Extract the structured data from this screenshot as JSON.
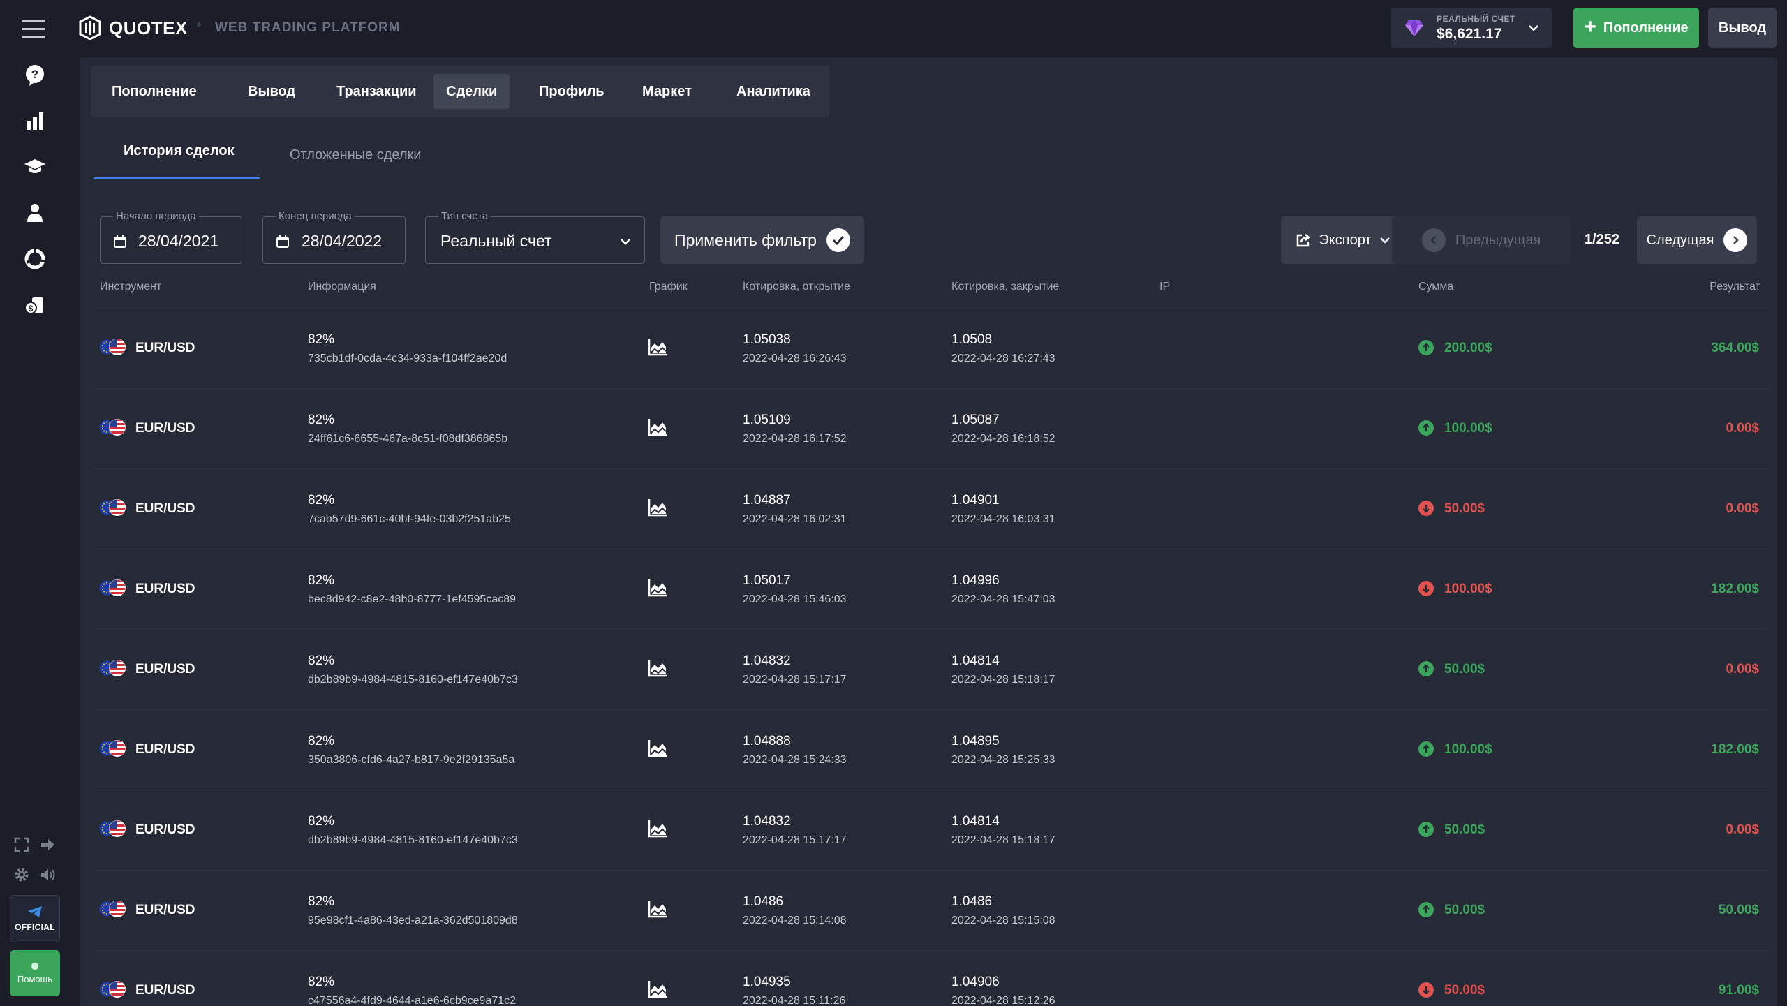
{
  "colors": {
    "green": "#3ba55c",
    "red": "#e0524f",
    "accent_blue": "#3d7be6",
    "background": "#1b1e29",
    "panel": "#262a36"
  },
  "header": {
    "logo": "QUOTEX",
    "tagline": "WEB TRADING PLATFORM",
    "account_label": "РЕАЛЬНЫЙ СЧЕТ",
    "balance": "$6,621.17",
    "deposit_label": "Пополнение",
    "withdraw_label": "Вывод"
  },
  "sidebar": {
    "icons": [
      "menu-icon",
      "help-icon",
      "chart-icon",
      "education-icon",
      "profile-icon",
      "market-icon",
      "coins-icon"
    ],
    "official_label": "OFFICIAL",
    "help_label": "Помощь"
  },
  "nav": {
    "tabs": [
      "Пополнение",
      "Вывод",
      "Транзакции",
      "Сделки",
      "Профиль",
      "Маркет",
      "Аналитика"
    ],
    "active": "Сделки"
  },
  "subtabs": [
    "История сделок",
    "Отложенные сделки"
  ],
  "filters": {
    "start_label": "Начало периода",
    "start_value": "28/04/2021",
    "end_label": "Конец периода",
    "end_value": "28/04/2022",
    "account_type_label": "Тип счета",
    "account_type_value": "Реальный счет",
    "apply_label": "Применить фильтр",
    "export_label": "Экспорт",
    "prev_label": "Предыдущая",
    "page": "1/252",
    "next_label": "Следущая"
  },
  "table": {
    "headers": [
      "Инструмент",
      "Информация",
      "График",
      "Котировка, открытие",
      "Котировка, закрытие",
      "IP",
      "Сумма",
      "Результат"
    ],
    "rows": [
      {
        "instrument": "EUR/USD",
        "percent": "82%",
        "id": "735cb1df-0cda-4c34-933a-f104ff2ae20d",
        "open_quote": "1.05038",
        "open_time": "2022-04-28 16:26:43",
        "close_quote": "1.0508",
        "close_time": "2022-04-28 16:27:43",
        "ip": "",
        "direction": "up",
        "amount": "200.00$",
        "result": "364.00$",
        "result_positive": true
      },
      {
        "instrument": "EUR/USD",
        "percent": "82%",
        "id": "24ff61c6-6655-467a-8c51-f08df386865b",
        "open_quote": "1.05109",
        "open_time": "2022-04-28 16:17:52",
        "close_quote": "1.05087",
        "close_time": "2022-04-28 16:18:52",
        "ip": "",
        "direction": "up",
        "amount": "100.00$",
        "result": "0.00$",
        "result_positive": false
      },
      {
        "instrument": "EUR/USD",
        "percent": "82%",
        "id": "7cab57d9-661c-40bf-94fe-03b2f251ab25",
        "open_quote": "1.04887",
        "open_time": "2022-04-28 16:02:31",
        "close_quote": "1.04901",
        "close_time": "2022-04-28 16:03:31",
        "ip": "",
        "direction": "down",
        "amount": "50.00$",
        "result": "0.00$",
        "result_positive": false
      },
      {
        "instrument": "EUR/USD",
        "percent": "82%",
        "id": "bec8d942-c8e2-48b0-8777-1ef4595cac89",
        "open_quote": "1.05017",
        "open_time": "2022-04-28 15:46:03",
        "close_quote": "1.04996",
        "close_time": "2022-04-28 15:47:03",
        "ip": "",
        "direction": "down",
        "amount": "100.00$",
        "result": "182.00$",
        "result_positive": true
      },
      {
        "instrument": "EUR/USD",
        "percent": "82%",
        "id": "db2b89b9-4984-4815-8160-ef147e40b7c3",
        "open_quote": "1.04832",
        "open_time": "2022-04-28 15:17:17",
        "close_quote": "1.04814",
        "close_time": "2022-04-28 15:18:17",
        "ip": "",
        "direction": "up",
        "amount": "50.00$",
        "result": "0.00$",
        "result_positive": false
      },
      {
        "instrument": "EUR/USD",
        "percent": "82%",
        "id": "350a3806-cfd6-4a27-b817-9e2f29135a5a",
        "open_quote": "1.04888",
        "open_time": "2022-04-28 15:24:33",
        "close_quote": "1.04895",
        "close_time": "2022-04-28 15:25:33",
        "ip": "",
        "direction": "up",
        "amount": "100.00$",
        "result": "182.00$",
        "result_positive": true
      },
      {
        "instrument": "EUR/USD",
        "percent": "82%",
        "id": "db2b89b9-4984-4815-8160-ef147e40b7c3",
        "open_quote": "1.04832",
        "open_time": "2022-04-28 15:17:17",
        "close_quote": "1.04814",
        "close_time": "2022-04-28 15:18:17",
        "ip": "",
        "direction": "up",
        "amount": "50.00$",
        "result": "0.00$",
        "result_positive": false
      },
      {
        "instrument": "EUR/USD",
        "percent": "82%",
        "id": "95e98cf1-4a86-43ed-a21a-362d501809d8",
        "open_quote": "1.0486",
        "open_time": "2022-04-28 15:14:08",
        "close_quote": "1.0486",
        "close_time": "2022-04-28 15:15:08",
        "ip": "",
        "direction": "up",
        "amount": "50.00$",
        "result": "50.00$",
        "result_positive": true
      },
      {
        "instrument": "EUR/USD",
        "percent": "82%",
        "id": "c47556a4-4fd9-4644-a1e6-6cb9ce9a71c2",
        "open_quote": "1.04935",
        "open_time": "2022-04-28 15:11:26",
        "close_quote": "1.04906",
        "close_time": "2022-04-28 15:12:26",
        "ip": "",
        "direction": "down",
        "amount": "50.00$",
        "result": "91.00$",
        "result_positive": true
      }
    ]
  }
}
